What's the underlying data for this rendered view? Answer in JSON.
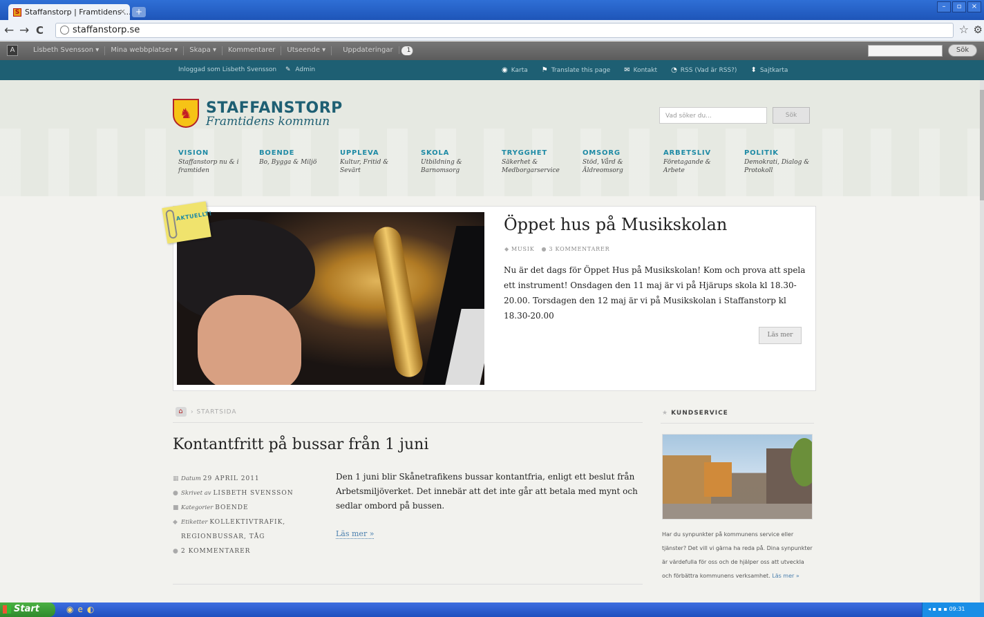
{
  "browser": {
    "tab_title": "Staffanstorp | Framtidens ...",
    "tab_close": "×",
    "new_tab": "+",
    "url": "staffanstorp.se",
    "back": "←",
    "forward": "→",
    "reload": "C",
    "bookmark_icon": "☆",
    "menu_icon": "🔧"
  },
  "adminbar": {
    "items": [
      "Lisbeth Svensson ▾",
      "Mina webbplatser ▾",
      "Skapa ▾",
      "Kommentarer",
      "Utseende ▾",
      "Uppdateringar"
    ],
    "updates_count": "1",
    "search_button": "Sök"
  },
  "topbar": {
    "logged_in": "Inloggad som Lisbeth Svensson",
    "admin": "Admin",
    "links": [
      "Karta",
      "Translate this page",
      "Kontakt",
      "RSS (Vad är RSS?)",
      "Sajtkarta"
    ]
  },
  "header": {
    "logo_title": "STAFFANSTORP",
    "logo_subtitle": "Framtidens kommun",
    "search_placeholder": "Vad söker du...",
    "search_button": "Sök"
  },
  "nav": [
    {
      "title": "VISION",
      "sub": "Staffanstorp nu & i framtiden"
    },
    {
      "title": "BOENDE",
      "sub": "Bo, Bygga & Miljö"
    },
    {
      "title": "UPPLEVA",
      "sub": "Kultur, Fritid & Sevärt"
    },
    {
      "title": "SKOLA",
      "sub": "Utbildning & Barnomsorg"
    },
    {
      "title": "TRYGGHET",
      "sub": "Säkerhet & Medborgarservice"
    },
    {
      "title": "OMSORG",
      "sub": "Stöd, Vård & Äldreomsorg"
    },
    {
      "title": "ARBETSLIV",
      "sub": "Företagande & Arbete"
    },
    {
      "title": "POLITIK",
      "sub": "Demokrati, Dialog & Protokoll"
    }
  ],
  "featured": {
    "tag": "AKTUELLT!",
    "title": "Öppet hus på Musikskolan",
    "category": "MUSIK",
    "comments": "3 KOMMENTARER",
    "text": "Nu är det dags för Öppet Hus på Musikskolan! Kom och prova att spela ett instrument! Onsdagen den 11 maj är vi på Hjärups skola kl 18.30-20.00. Torsdagen den 12 maj är vi på Musikskolan i Staffanstorp kl 18.30-20.00",
    "read_more": "Läs mer"
  },
  "breadcrumb": {
    "current": "STARTSIDA"
  },
  "post": {
    "title": "Kontantfritt på bussar från 1 juni",
    "date_label": "Datum",
    "date": "29 APRIL 2011",
    "author_label": "Skrivet av",
    "author": "LISBETH SVENSSON",
    "category_label": "Kategorier",
    "category": "BOENDE",
    "tags_label": "Etiketter",
    "tags_line1": "KOLLEKTIVTRAFIK,",
    "tags_line2": "REGIONBUSSAR, TÅG",
    "comments": "2 KOMMENTARER",
    "body": "Den 1 juni blir Skånetrafikens bussar kontantfria, enligt ett beslut från Arbetsmiljöverket. Det innebär att det inte går att betala med mynt och sedlar ombord på bussen.",
    "read_more": "Läs mer »"
  },
  "sidebar": {
    "title": "KUNDSERVICE",
    "text": "Har du synpunkter på kommunens service eller tjänster? Det vill vi gärna ha reda på. Dina synpunkter är värdefulla för oss och de hjälper oss att utveckla och förbättra kommunens verksamhet.",
    "link": "Läs mer »"
  },
  "taskbar": {
    "start": "Start",
    "clock": "09:31"
  },
  "colors": {
    "teal": "#1e5f73",
    "accent": "#1e8aa5",
    "link": "#4a7fae"
  }
}
